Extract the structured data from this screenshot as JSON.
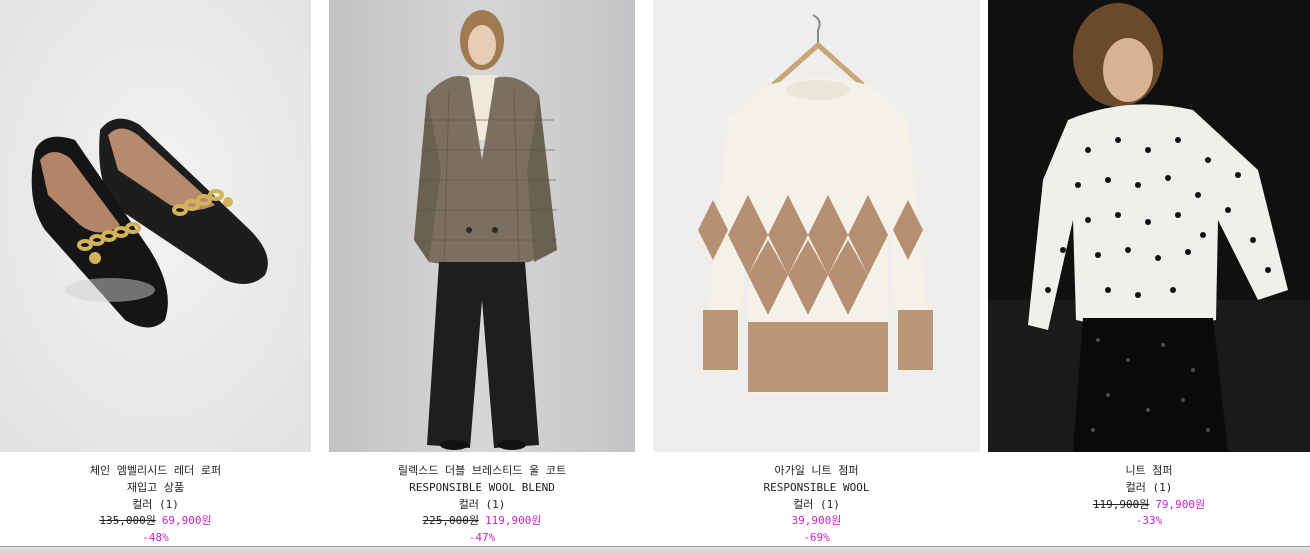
{
  "products": [
    {
      "name": "체인 엠벨리시드 레더 로퍼",
      "subtitle": "재입고 상품",
      "colors": "컬러 (1)",
      "original_price": "135,000원",
      "sale_price": "69,900원",
      "discount": "-48%"
    },
    {
      "name": "릴렉스드 더블 브레스티드 울 코트",
      "subtitle": "RESPONSIBLE WOOL BLEND",
      "colors": "컬러 (1)",
      "original_price": "225,000원",
      "sale_price": "119,900원",
      "discount": "-47%"
    },
    {
      "name": "아가일 니트 점퍼",
      "subtitle": "RESPONSIBLE WOOL",
      "colors": "컬러 (1)",
      "original_price": "",
      "sale_price": "39,900원",
      "discount": "-69%"
    },
    {
      "name": "니트 점퍼",
      "subtitle": "",
      "colors": "컬러 (1)",
      "original_price": "119,900원",
      "sale_price": "79,900원",
      "discount": "-33%"
    }
  ],
  "colors": {
    "sale": "#d020c8",
    "text": "#222222"
  }
}
